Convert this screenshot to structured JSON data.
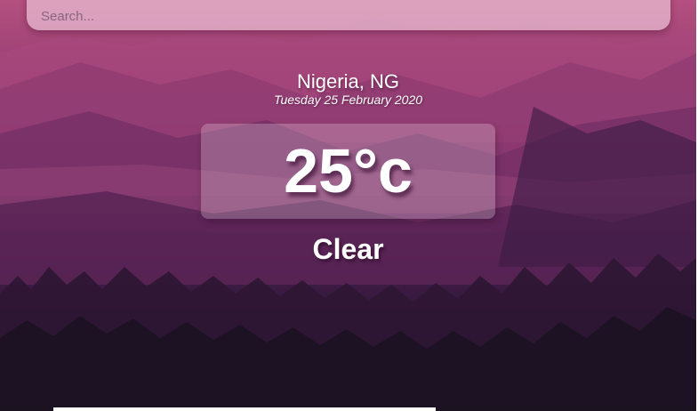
{
  "search": {
    "placeholder": "Search..."
  },
  "weather": {
    "location": "Nigeria, NG",
    "date": "Tuesday 25 February 2020",
    "temperature": "25°c",
    "condition": "Clear"
  },
  "background": {
    "icon": "mountain-landscape",
    "colors": {
      "sky": "#b3507f",
      "mid": "#7a2f67",
      "forest": "#18101f"
    }
  }
}
